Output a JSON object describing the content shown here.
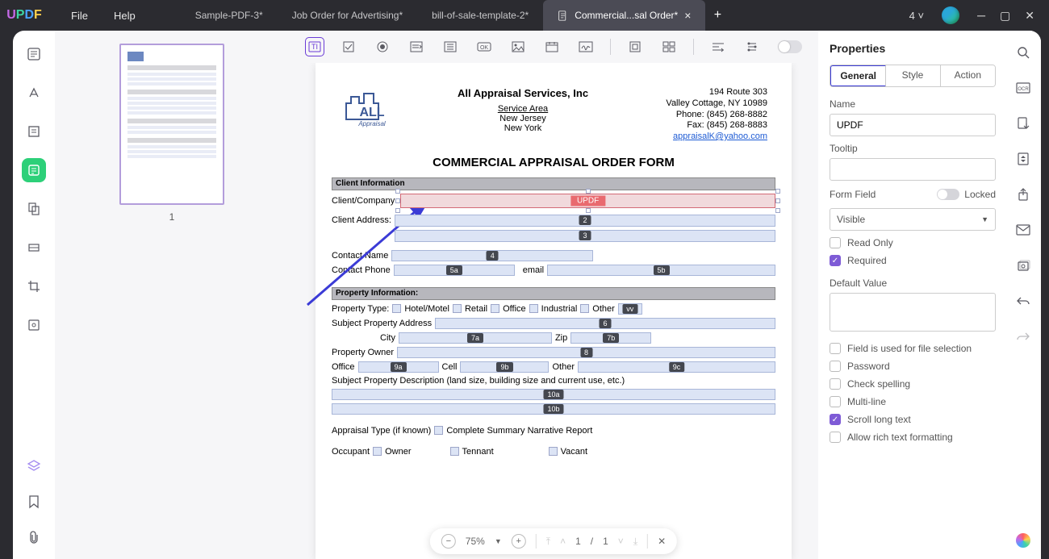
{
  "brand": "UPDF",
  "menu": {
    "file": "File",
    "help": "Help"
  },
  "tabs": [
    {
      "label": "Sample-PDF-3*"
    },
    {
      "label": "Job Order for Advertising*"
    },
    {
      "label": "bill-of-sale-template-2*"
    },
    {
      "label": "Commercial...sal Order*"
    }
  ],
  "titlebar": {
    "counter": "4"
  },
  "thumbnails": {
    "page": "1"
  },
  "document": {
    "company": "All Appraisal Services, Inc",
    "service_area": "Service Area",
    "loc1": "New Jersey",
    "loc2": "New York",
    "addr1": "194 Route 303",
    "addr2": "Valley Cottage, NY 10989",
    "phone": "Phone:   (845) 268-8882",
    "fax": "Fax:   (845) 268-8883",
    "email": "appraisalK@yahoo.com",
    "title": "COMMERCIAL APPRAISAL ORDER FORM",
    "sections": {
      "client": "Client Information",
      "property": "Property Information:"
    },
    "labels": {
      "client_company": "Client/Company:",
      "client_address": "Client Address:",
      "contact_name": "Contact Name",
      "contact_phone": "Contact Phone",
      "email": "email",
      "property_type": "Property Type:",
      "hotel": "Hotel/Motel",
      "retail": "Retail",
      "office": "Office",
      "industrial": "Industrial",
      "other": "Other",
      "subject_addr": "Subject Property Address",
      "city": "City",
      "zip": "Zip",
      "property_owner": "Property Owner",
      "office2": "Office",
      "cell": "Cell",
      "other2": "Other",
      "desc": "Subject Property Description (land size, building size and current use, etc.)",
      "appraisal_type": "Appraisal Type (if known)",
      "narrative": "Complete Summary Narrative Report",
      "occupant": "Occupant",
      "owner": "Owner",
      "tennant": "Tennant",
      "vacant": "Vacant"
    },
    "field_tags": {
      "selected": "UPDF",
      "t2": "2",
      "t3": "3",
      "t4": "4",
      "t5a": "5a",
      "t5b": "5b",
      "tvv": "vv",
      "t6": "6",
      "t7a": "7a",
      "t7b": "7b",
      "t8": "8",
      "t9a": "9a",
      "t9b": "9b",
      "t9c": "9c",
      "t10a": "10a",
      "t10b": "10b"
    }
  },
  "pagectl": {
    "zoom": "75%",
    "page_cur": "1",
    "page_sep": "/",
    "page_total": "1"
  },
  "props": {
    "title": "Properties",
    "tabs": {
      "general": "General",
      "style": "Style",
      "action": "Action"
    },
    "name_label": "Name",
    "name_value": "UPDF",
    "tooltip_label": "Tooltip",
    "tooltip_value": "",
    "form_field_label": "Form Field",
    "locked_label": "Locked",
    "visibility": "Visible",
    "read_only": "Read Only",
    "required": "Required",
    "default_label": "Default Value",
    "file_sel": "Field is used for file selection",
    "password": "Password",
    "spell": "Check spelling",
    "multiline": "Multi-line",
    "scroll": "Scroll long text",
    "richtext": "Allow rich text formatting"
  }
}
